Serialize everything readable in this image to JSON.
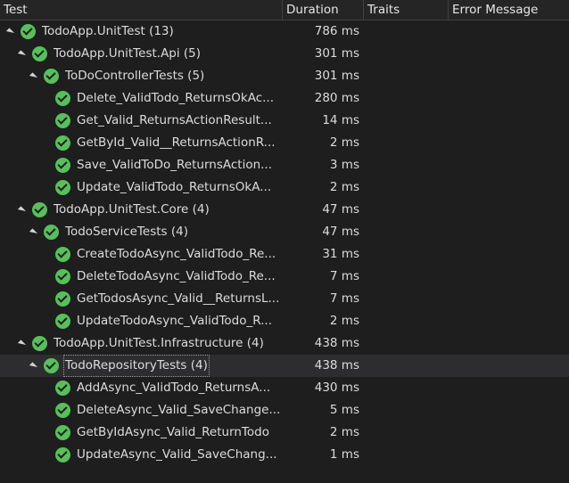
{
  "columns": {
    "test": "Test",
    "duration": "Duration",
    "traits": "Traits",
    "error": "Error Message"
  },
  "rows": [
    {
      "level": 0,
      "group": true,
      "name": "TodoApp.UnitTest  (13)",
      "duration": "786 ms"
    },
    {
      "level": 1,
      "group": true,
      "name": "TodoApp.UnitTest.Api  (5)",
      "duration": "301 ms"
    },
    {
      "level": 2,
      "group": true,
      "name": "ToDoControllerTests  (5)",
      "duration": "301 ms"
    },
    {
      "level": 3,
      "group": false,
      "name": "Delete_ValidTodo_ReturnsOkAc...",
      "duration": "280 ms"
    },
    {
      "level": 3,
      "group": false,
      "name": "Get_Valid_ReturnsActionResult...",
      "duration": "14 ms"
    },
    {
      "level": 3,
      "group": false,
      "name": "GetById_Valid__ReturnsActionR...",
      "duration": "2 ms"
    },
    {
      "level": 3,
      "group": false,
      "name": "Save_ValidToDo_ReturnsAction...",
      "duration": "3 ms"
    },
    {
      "level": 3,
      "group": false,
      "name": "Update_ValidTodo_ReturnsOkA...",
      "duration": "2 ms"
    },
    {
      "level": 1,
      "group": true,
      "name": "TodoApp.UnitTest.Core  (4)",
      "duration": "47 ms"
    },
    {
      "level": 2,
      "group": true,
      "name": "TodoServiceTests  (4)",
      "duration": "47 ms"
    },
    {
      "level": 3,
      "group": false,
      "name": "CreateTodoAsync_ValidTodo_Re...",
      "duration": "31 ms"
    },
    {
      "level": 3,
      "group": false,
      "name": "DeleteTodoAsync_ValidTodo_Re...",
      "duration": "7 ms"
    },
    {
      "level": 3,
      "group": false,
      "name": "GetTodosAsync_Valid__ReturnsL...",
      "duration": "7 ms"
    },
    {
      "level": 3,
      "group": false,
      "name": "UpdateTodoAsync_ValidTodo_R...",
      "duration": "2 ms"
    },
    {
      "level": 1,
      "group": true,
      "name": "TodoApp.UnitTest.Infrastructure  (4)",
      "duration": "438 ms"
    },
    {
      "level": 2,
      "group": true,
      "name": "TodoRepositoryTests  (4)",
      "duration": "438 ms",
      "selected": true
    },
    {
      "level": 3,
      "group": false,
      "name": "AddAsync_ValidTodo_ReturnsA...",
      "duration": "430 ms"
    },
    {
      "level": 3,
      "group": false,
      "name": "DeleteAsync_Valid_SaveChange...",
      "duration": "5 ms"
    },
    {
      "level": 3,
      "group": false,
      "name": "GetByIdAsync_Valid_ReturnTodo",
      "duration": "2 ms"
    },
    {
      "level": 3,
      "group": false,
      "name": "UpdateAsync_Valid_SaveChang...",
      "duration": "1 ms"
    }
  ],
  "icons": {
    "passed": "passed-check-icon",
    "expander": "expanded-triangle-icon"
  },
  "colors": {
    "background": "#1e1e1e",
    "passed": "#57c05b",
    "text": "#dcdcdc"
  }
}
